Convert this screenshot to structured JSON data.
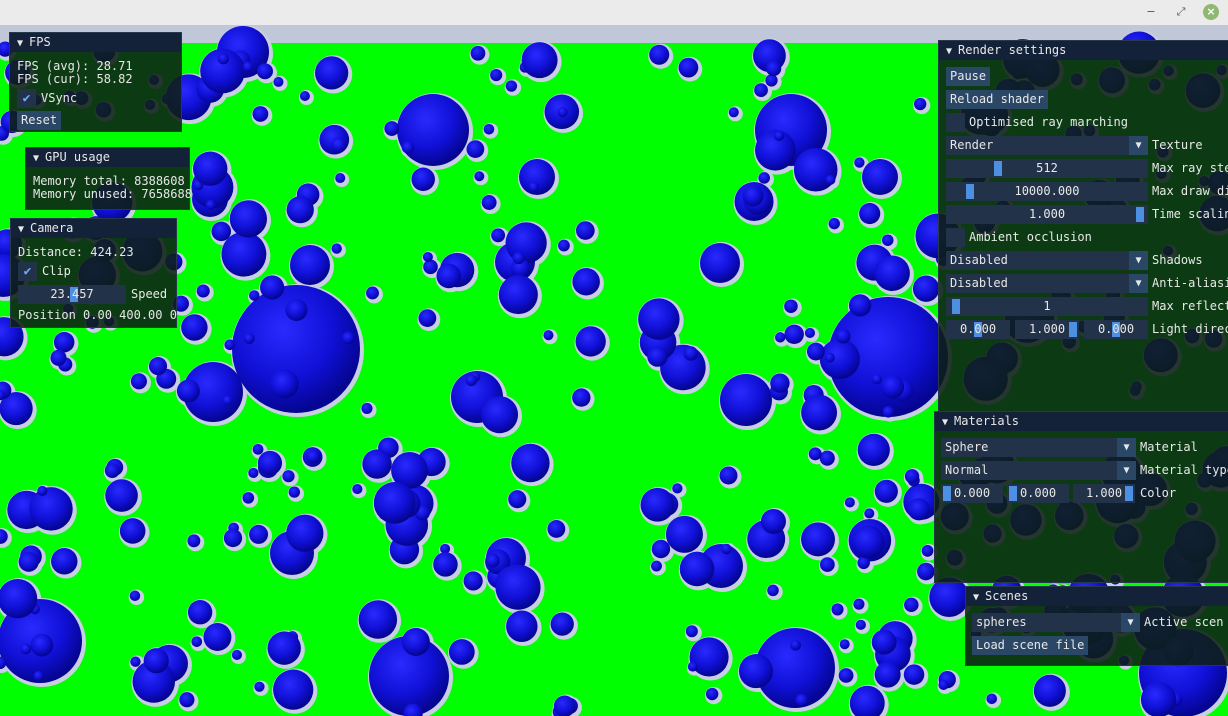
{
  "window": {
    "minimize_glyph": "−",
    "maximize_glyph": "⤢",
    "close_glyph": "×"
  },
  "colors": {
    "background_green": "#00ff00",
    "sphere_blue": "#1010d0",
    "panel_bg": "#0e2016",
    "title_bg": "#132238",
    "widget_bg": "#223248",
    "button_bg": "#2a4766",
    "accent": "#4d8fe0"
  },
  "panels": {
    "fps": {
      "title": "FPS",
      "avg": "FPS (avg): 28.71",
      "cur": "FPS (cur): 58.82",
      "vsync_label": "VSync",
      "vsync_checked": true,
      "reset_label": "Reset"
    },
    "gpu": {
      "title": "GPU usage",
      "total": "Memory total: 8388608",
      "unused": "Memory unused: 7658688"
    },
    "camera": {
      "title": "Camera",
      "distance": "Distance: 424.23",
      "clip_label": "Clip",
      "clip_checked": true,
      "speed_value": "23.457",
      "speed_label": "Speed",
      "position": "Position 0.00 400.00 0"
    },
    "render": {
      "title": "Render settings",
      "pause_label": "Pause",
      "reload_label": "Reload shader",
      "optimised_label": "Optimised ray marching",
      "optimised_checked": false,
      "texture_value": "Render",
      "texture_label": "Texture",
      "max_ray_steps_value": "512",
      "max_ray_steps_label": "Max ray ste",
      "max_draw_value": "10000.000",
      "max_draw_label": "Max draw di",
      "time_scale_value": "1.000",
      "time_scale_label": "Time scalin",
      "ambient_label": "Ambient occlusion",
      "ambient_checked": false,
      "shadows_value": "Disabled",
      "shadows_label": "Shadows",
      "aa_value": "Disabled",
      "aa_label": "Anti-aliasi",
      "max_reflect_value": "1",
      "max_reflect_label": "Max reflect",
      "light_x": "0.000",
      "light_y": "1.000",
      "light_z": "0.000",
      "light_label": "Light direc"
    },
    "materials": {
      "title": "Materials",
      "material_value": "Sphere",
      "material_label": "Material",
      "type_value": "Normal",
      "type_label": "Material type",
      "color_r": "0.000",
      "color_g": "0.000",
      "color_b": "1.000",
      "color_label": "Color"
    },
    "scenes": {
      "title": "Scenes",
      "active_value": "spheres",
      "active_label": "Active scen",
      "load_label": "Load scene file"
    }
  }
}
